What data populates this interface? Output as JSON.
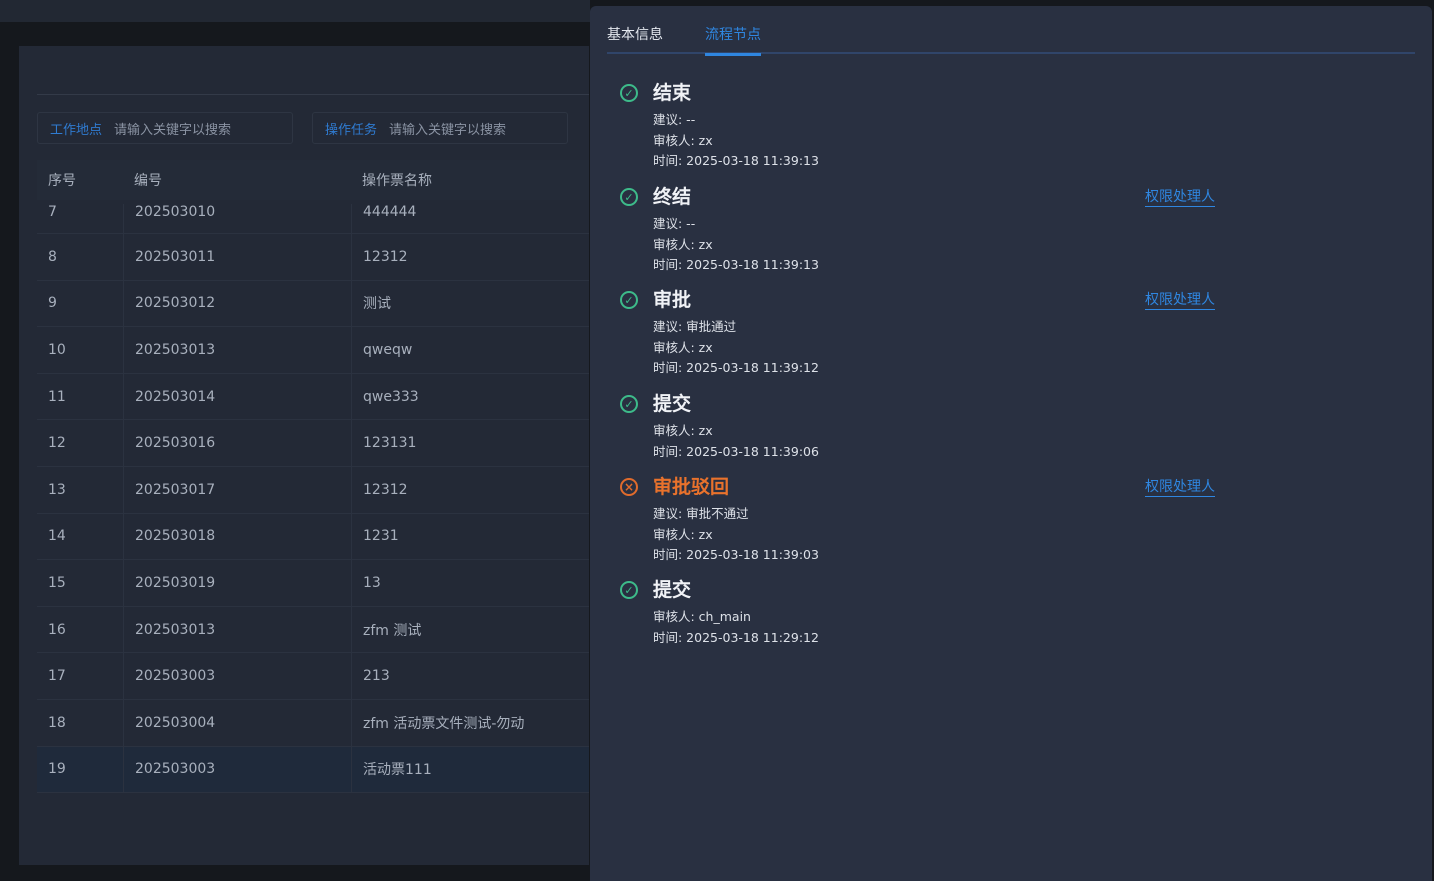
{
  "search": {
    "location_label": "工作地点",
    "location_placeholder": "请输入关键字以搜索",
    "task_label": "操作任务",
    "task_placeholder": "请输入关键字以搜索"
  },
  "table": {
    "columns": [
      "序号",
      "编号",
      "操作票名称"
    ],
    "rows": [
      {
        "index": "7",
        "code": "202503010",
        "name": "444444"
      },
      {
        "index": "8",
        "code": "202503011",
        "name": "12312"
      },
      {
        "index": "9",
        "code": "202503012",
        "name": "测试"
      },
      {
        "index": "10",
        "code": "202503013",
        "name": "qweqw"
      },
      {
        "index": "11",
        "code": "202503014",
        "name": "qwe333"
      },
      {
        "index": "12",
        "code": "202503016",
        "name": "123131"
      },
      {
        "index": "13",
        "code": "202503017",
        "name": "12312"
      },
      {
        "index": "14",
        "code": "202503018",
        "name": "1231"
      },
      {
        "index": "15",
        "code": "202503019",
        "name": "13"
      },
      {
        "index": "16",
        "code": "202503013",
        "name": "zfm 测试"
      },
      {
        "index": "17",
        "code": "202503003",
        "name": "213"
      },
      {
        "index": "18",
        "code": "202503004",
        "name": "zfm 活动票文件测试-勿动"
      },
      {
        "index": "19",
        "code": "202503003",
        "name": "活动票111"
      }
    ]
  },
  "drawer": {
    "tabs": [
      {
        "label": "基本信息",
        "active": false
      },
      {
        "label": "流程节点",
        "active": true
      }
    ],
    "nodes": [
      {
        "status": "done",
        "icon": "check-circle-icon",
        "title": "结束",
        "lines": [
          "建议: --",
          "审核人: zx",
          "时间: 2025-03-18 11:39:13"
        ],
        "link": ""
      },
      {
        "status": "done",
        "icon": "check-circle-icon",
        "title": "终结",
        "lines": [
          "建议: --",
          "审核人: zx",
          "时间: 2025-03-18 11:39:13"
        ],
        "link": "权限处理人"
      },
      {
        "status": "done",
        "icon": "check-circle-icon",
        "title": "审批",
        "lines": [
          "建议: 审批通过",
          "审核人: zx",
          "时间: 2025-03-18 11:39:12"
        ],
        "link": "权限处理人"
      },
      {
        "status": "done",
        "icon": "check-circle-icon",
        "title": "提交",
        "lines": [
          "审核人: zx",
          "时间: 2025-03-18 11:39:06"
        ],
        "link": ""
      },
      {
        "status": "rejected",
        "icon": "x-circle-icon",
        "title": "审批驳回",
        "lines": [
          "建议: 审批不通过",
          "审核人: zx",
          "时间: 2025-03-18 11:39:03"
        ],
        "link": "权限处理人"
      },
      {
        "status": "done",
        "icon": "check-circle-icon",
        "title": "提交",
        "lines": [
          "审核人: ch_main",
          "时间: 2025-03-18 11:29:12"
        ],
        "link": ""
      }
    ]
  },
  "colors": {
    "accent": "#2f86e0",
    "success": "#3dbb8a",
    "reject": "#e9722c"
  }
}
